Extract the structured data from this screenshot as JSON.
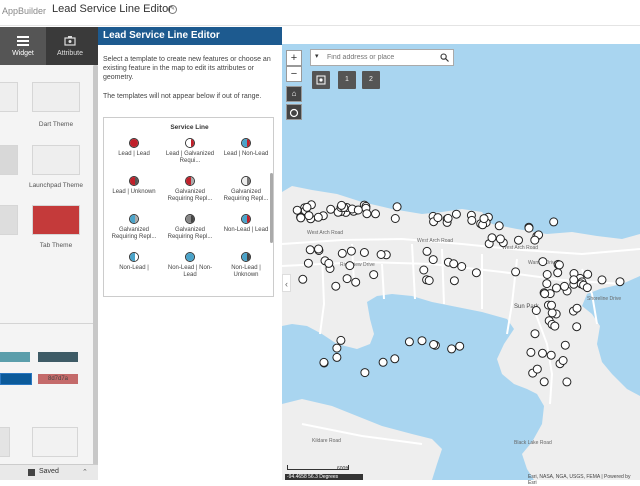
{
  "app": {
    "name": "AppBuilder",
    "project_title": "Lead Service Line Editor"
  },
  "left_panel": {
    "tabs": [
      {
        "label": "Widget",
        "icon": "grid-icon"
      },
      {
        "label": "Attribute",
        "icon": "gear-settings-icon"
      }
    ],
    "themes": [
      "me",
      "Dart Theme",
      "heme",
      "Launchpad Theme",
      "heme",
      "Tab Theme"
    ],
    "swatches": [
      {
        "color": "#5b9eab"
      },
      {
        "color": "#3e5b66"
      },
      {
        "color": "#0b5a9a"
      },
      {
        "color": "#c46a6a",
        "label": "8d7d7a"
      }
    ],
    "footer": {
      "saved_label": "Saved"
    }
  },
  "widget_panel": {
    "title": "Lead Service Line Editor",
    "intro": "Select a template to create new features or choose an existing feature in the map to edit its attributes or geometry.",
    "note": "The templates will not appear below if out of range.",
    "layer_title": "Service Line",
    "templates": [
      {
        "label": "Lead | Lead",
        "left": "#c0202a",
        "right": "#c0202a"
      },
      {
        "label": "Lead | Galvanized Requi...",
        "left": "#ffffff",
        "right": "#c0202a"
      },
      {
        "label": "Lead | Non-Lead",
        "left": "#4aa3c9",
        "right": "#c0202a"
      },
      {
        "label": "Lead | Unknown",
        "left": "#c0202a",
        "right": "#555555"
      },
      {
        "label": "Galvanized Requiring Repl...",
        "left": "#c0202a",
        "right": "#aaaaaa"
      },
      {
        "label": "Galvanized Requiring Repl...",
        "left": "#eeeeee",
        "right": "#777777"
      },
      {
        "label": "Galvanized Requiring Repl...",
        "left": "#4aa3c9",
        "right": "#aaaaaa"
      },
      {
        "label": "Galvanized Requiring Repl...",
        "left": "#888888",
        "right": "#444444"
      },
      {
        "label": "Non-Lead | Lead",
        "left": "#4aa3c9",
        "right": "#c0202a"
      },
      {
        "label": "Non-Lead |",
        "left": "#4aa3c9",
        "right": "#ffffff"
      },
      {
        "label": "Non-Lead | Non-Lead",
        "left": "#4aa3c9",
        "right": "#4aa3c9"
      },
      {
        "label": "Non-Lead | Unknown",
        "left": "#4aa3c9",
        "right": "#444444"
      }
    ]
  },
  "map": {
    "search_placeholder": "Find address or place",
    "tools": [
      "1",
      "2"
    ],
    "scale_label": "600ft",
    "coords": "-94.4658 56.3 Degrees",
    "attribution": "Esri, NASA, NGA, USGS, FEMA | Powered by Esri",
    "place_labels": [
      {
        "text": "West Arch Road"
      },
      {
        "text": "West Arch Road"
      },
      {
        "text": "West Arch Road"
      },
      {
        "text": "Sun Park"
      },
      {
        "text": "Shoreline Drive"
      },
      {
        "text": "Kildare Road"
      },
      {
        "text": "Black Lake Road"
      },
      {
        "text": "Riverview Drive"
      },
      {
        "text": "Warren Drive"
      }
    ],
    "water_color": "#a9d5f0",
    "land_color": "#eeeeee"
  }
}
